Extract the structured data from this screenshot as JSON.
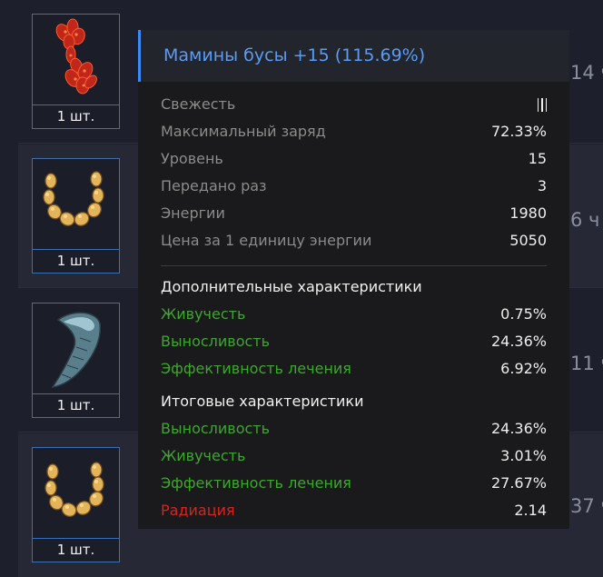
{
  "items": [
    {
      "count": "1 шт.",
      "icon": "red-crystal-artifact-icon",
      "side": "14 ч"
    },
    {
      "count": "1 шт.",
      "icon": "amber-beads-artifact-icon",
      "side": "6 ч"
    },
    {
      "count": "1 шт.",
      "icon": "fang-artifact-icon",
      "side": "11 ч"
    },
    {
      "count": "1 шт.",
      "icon": "amber-beads-artifact-icon",
      "side": "37 ч"
    }
  ],
  "tooltip": {
    "title": "Мамины бусы +15 (115.69%)",
    "stats": [
      {
        "label": "Свежесть",
        "freshness_bars": 3
      },
      {
        "label": "Максимальный заряд",
        "value": "72.33%"
      },
      {
        "label": "Уровень",
        "value": "15"
      },
      {
        "label": "Передано раз",
        "value": "3"
      },
      {
        "label": "Энергии",
        "value": "1980"
      },
      {
        "label": "Цена за 1 единицу энергии",
        "value": "5050"
      }
    ],
    "additional": {
      "heading": "Дополнительные характеристики",
      "rows": [
        {
          "label": "Живучесть",
          "value": "0.75%"
        },
        {
          "label": "Выносливость",
          "value": "24.36%"
        },
        {
          "label": "Эффективность лечения",
          "value": "6.92%"
        }
      ]
    },
    "total": {
      "heading": "Итоговые характеристики",
      "rows": [
        {
          "label": "Выносливость",
          "value": "24.36%"
        },
        {
          "label": "Живучесть",
          "value": "3.01%"
        },
        {
          "label": "Эффективность лечения",
          "value": "27.67%"
        },
        {
          "label": "Радиация",
          "value": "2.14",
          "negative": true
        }
      ]
    }
  },
  "colors": {
    "accent": "#3e8bf0",
    "positive": "#3fa62f",
    "negative": "#d8241d"
  }
}
